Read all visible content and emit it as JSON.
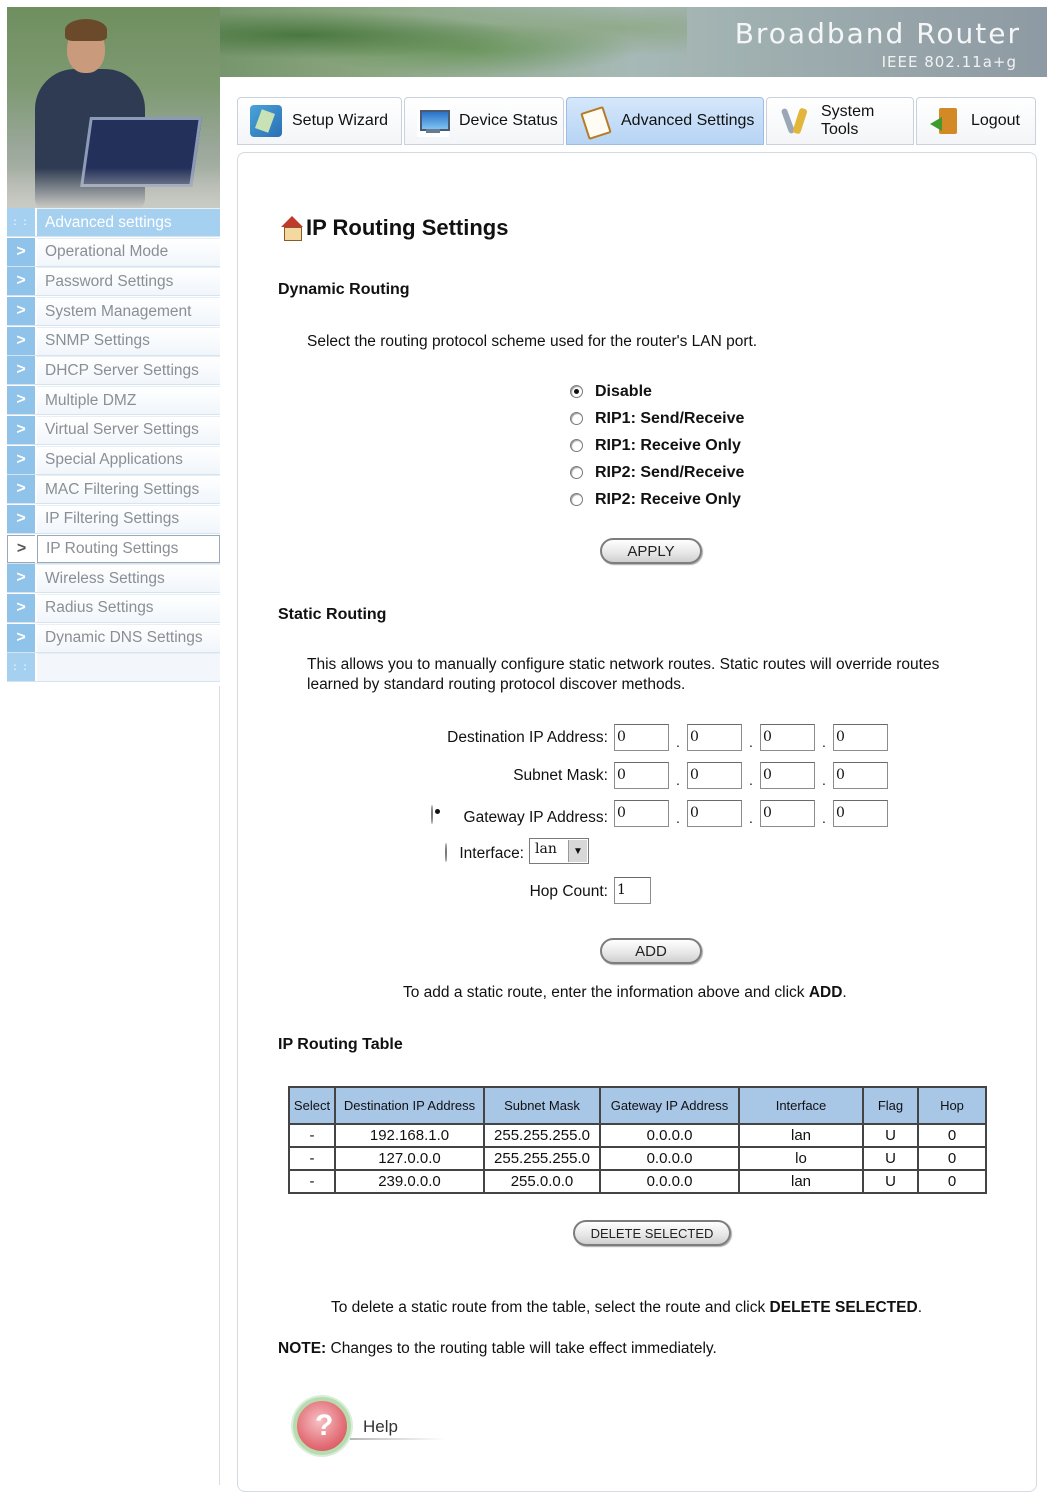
{
  "header": {
    "brand": "Broadband Router",
    "subtitle": "IEEE 802.11a+g"
  },
  "tabs": [
    {
      "label": "Setup Wizard",
      "icon": "wizard-icon",
      "active": false
    },
    {
      "label": "Device Status",
      "icon": "monitor-icon",
      "active": false
    },
    {
      "label": "Advanced Settings",
      "icon": "document-icon",
      "active": true
    },
    {
      "label": "System Tools",
      "icon": "tools-icon",
      "active": false
    },
    {
      "label": "Logout",
      "icon": "logout-icon",
      "active": false
    }
  ],
  "sidebar": {
    "header": "Advanced settings",
    "items": [
      {
        "label": "Operational Mode"
      },
      {
        "label": "Password Settings"
      },
      {
        "label": "System Management"
      },
      {
        "label": "SNMP Settings"
      },
      {
        "label": "DHCP Server Settings"
      },
      {
        "label": "Multiple DMZ"
      },
      {
        "label": "Virtual Server Settings"
      },
      {
        "label": "Special Applications"
      },
      {
        "label": "MAC Filtering Settings"
      },
      {
        "label": "IP Filtering Settings"
      },
      {
        "label": "IP Routing Settings",
        "active": true
      },
      {
        "label": "Wireless Settings"
      },
      {
        "label": "Radius Settings"
      },
      {
        "label": "Dynamic DNS Settings"
      }
    ]
  },
  "page": {
    "title": "IP Routing Settings"
  },
  "dynamic": {
    "heading": "Dynamic Routing",
    "description": "Select the routing protocol scheme used for the router's LAN port.",
    "options": [
      {
        "label": "Disable",
        "selected": true
      },
      {
        "label": "RIP1: Send/Receive",
        "selected": false
      },
      {
        "label": "RIP1: Receive Only",
        "selected": false
      },
      {
        "label": "RIP2: Send/Receive",
        "selected": false
      },
      {
        "label": "RIP2: Receive Only",
        "selected": false
      }
    ],
    "apply_label": "APPLY"
  },
  "static": {
    "heading": "Static Routing",
    "description_line1": "This allows you to manually configure static network routes. Static routes will override routes",
    "description_line2": "learned by standard routing protocol discover methods.",
    "dest_label": "Destination IP Address:",
    "dest_values": [
      "0",
      "0",
      "0",
      "0"
    ],
    "mask_label": "Subnet Mask:",
    "mask_values": [
      "0",
      "0",
      "0",
      "0"
    ],
    "gateway_label": "Gateway IP Address:",
    "gateway_values": [
      "0",
      "0",
      "0",
      "0"
    ],
    "gateway_selected": true,
    "interface_label": "Interface:",
    "interface_value": "lan",
    "interface_selected": false,
    "hop_label": "Hop Count:",
    "hop_value": "1",
    "add_label": "ADD",
    "add_hint_prefix": "To add a static route, enter the information above and click ",
    "add_hint_bold": "ADD",
    "add_hint_suffix": "."
  },
  "table": {
    "heading": "IP Routing Table",
    "columns": [
      "Select",
      "Destination IP Address",
      "Subnet Mask",
      "Gateway IP Address",
      "Interface",
      "Flag",
      "Hop"
    ],
    "rows": [
      [
        "-",
        "192.168.1.0",
        "255.255.255.0",
        "0.0.0.0",
        "lan",
        "U",
        "0"
      ],
      [
        "-",
        "127.0.0.0",
        "255.255.255.0",
        "0.0.0.0",
        "lo",
        "U",
        "0"
      ],
      [
        "-",
        "239.0.0.0",
        "255.0.0.0",
        "0.0.0.0",
        "lan",
        "U",
        "0"
      ]
    ],
    "delete_label": "DELETE SELECTED",
    "delete_hint_prefix": "To delete a static route from the table, select the route and click ",
    "delete_hint_bold": "DELETE SELECTED",
    "delete_hint_suffix": "."
  },
  "note": {
    "prefix": "NOTE:",
    "text": " Changes to the routing table will take effect immediately."
  },
  "help": {
    "label": "Help"
  }
}
